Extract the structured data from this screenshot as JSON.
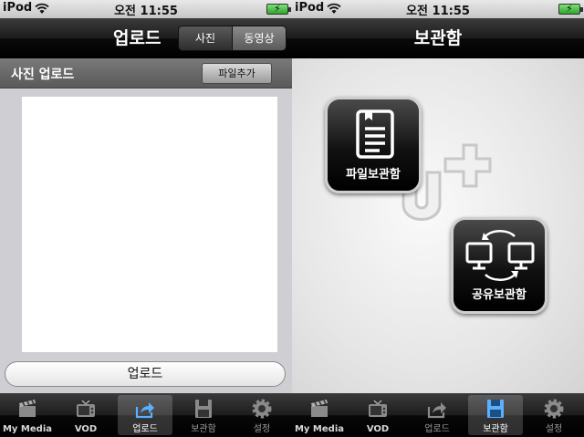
{
  "status": {
    "carrier": "iPod",
    "time": "오전 11:55"
  },
  "upload_screen": {
    "title": "업로드",
    "segments": [
      "사진",
      "동영상"
    ],
    "section_title": "사진 업로드",
    "add_file_label": "파일추가",
    "upload_label": "업로드"
  },
  "storage_screen": {
    "title": "보관함",
    "file_storage_label": "파일보관함",
    "shared_storage_label": "공유보관함"
  },
  "tabs": [
    {
      "label": "My Media",
      "icon": "clapperboard-icon"
    },
    {
      "label": "VOD",
      "icon": "tv-icon"
    },
    {
      "label": "업로드",
      "icon": "share-arrow-icon"
    },
    {
      "label": "보관함",
      "icon": "floppy-disk-icon"
    },
    {
      "label": "설정",
      "icon": "gear-icon"
    }
  ],
  "left_active_tab": "업로드",
  "right_active_tab": "보관함"
}
